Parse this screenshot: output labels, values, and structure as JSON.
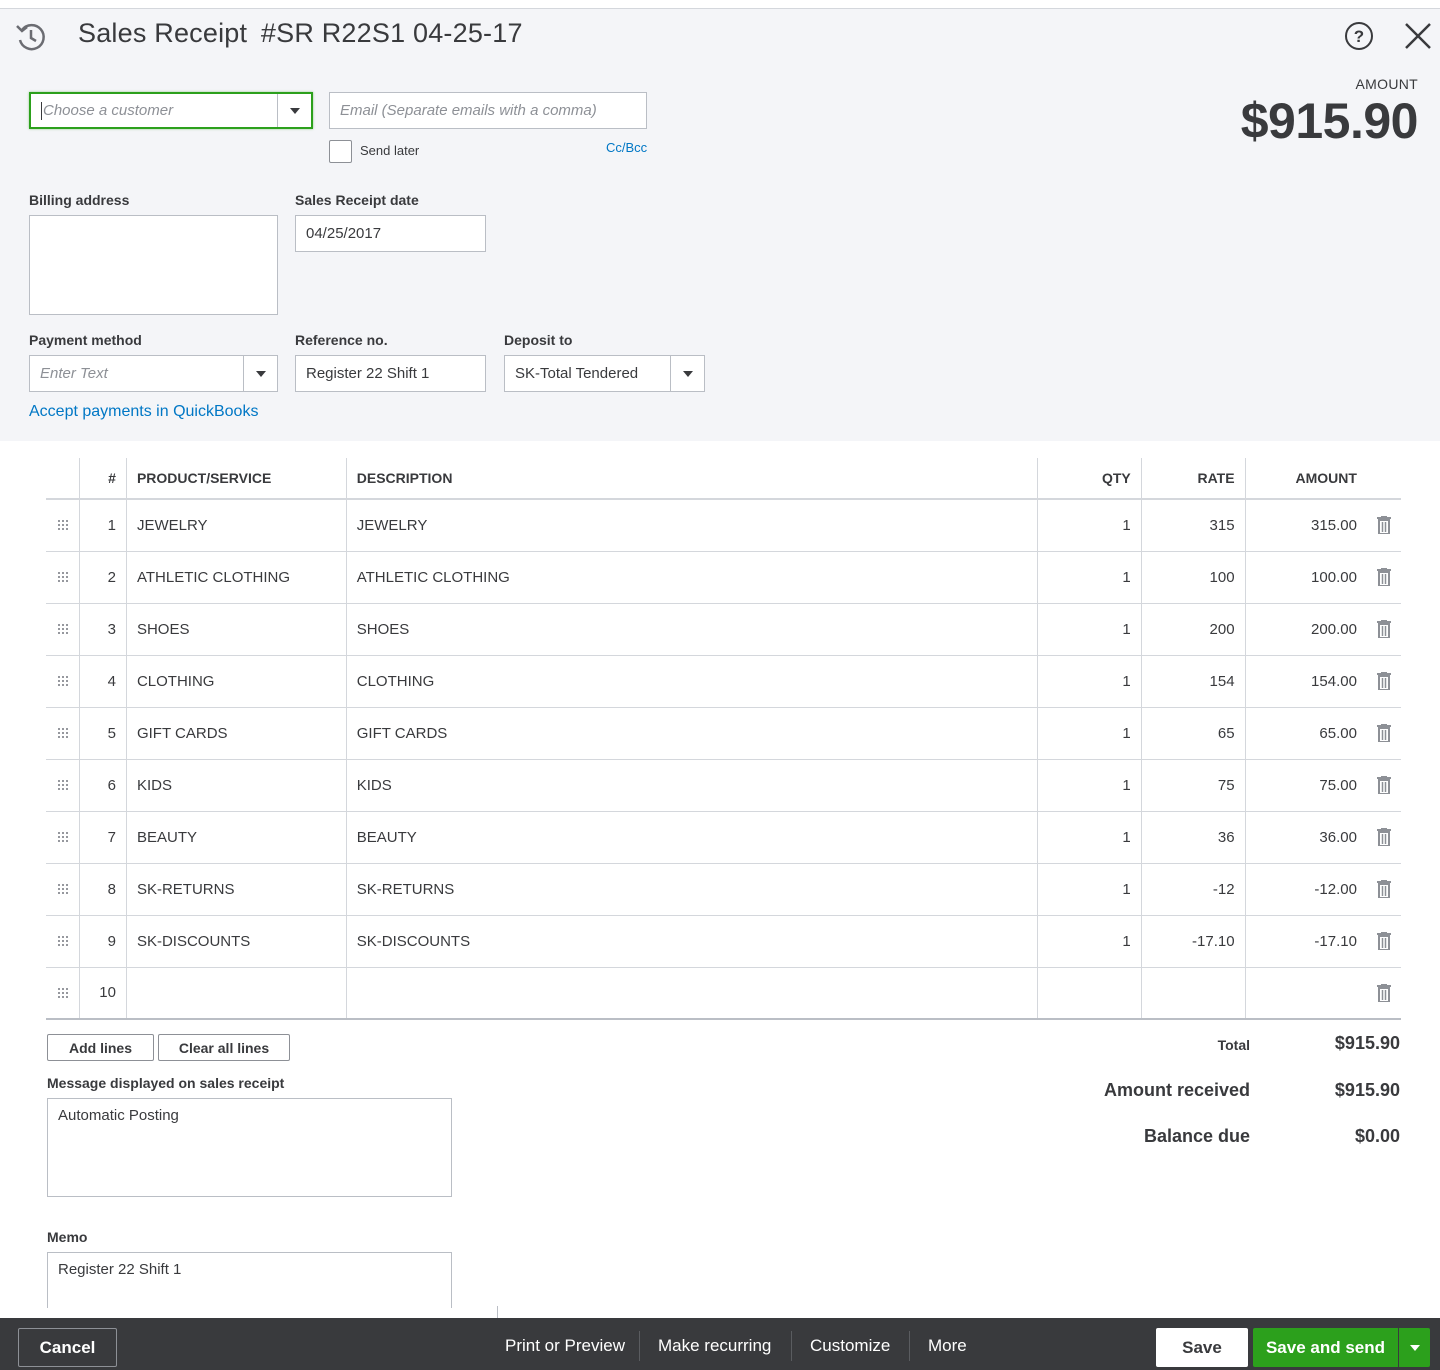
{
  "header": {
    "title": "Sales Receipt",
    "receipt_number": "#SR R22S1 04-25-17",
    "amount_label": "AMOUNT",
    "amount_value": "$915.90"
  },
  "form": {
    "customer_placeholder": "Choose a customer",
    "email_placeholder": "Email (Separate emails with a comma)",
    "send_later_label": "Send later",
    "send_later_checked": false,
    "cc_bcc_label": "Cc/Bcc",
    "billing_address_label": "Billing address",
    "billing_address_value": "",
    "sales_receipt_date_label": "Sales Receipt date",
    "sales_receipt_date_value": "04/25/2017",
    "payment_method_label": "Payment method",
    "payment_method_placeholder": "Enter Text",
    "reference_no_label": "Reference no.",
    "reference_no_value": "Register 22 Shift 1",
    "deposit_to_label": "Deposit to",
    "deposit_to_value": "SK-Total Tendered",
    "accept_payments_link": "Accept payments in QuickBooks"
  },
  "table": {
    "headers": {
      "num": "#",
      "product": "PRODUCT/SERVICE",
      "description": "DESCRIPTION",
      "qty": "QTY",
      "rate": "RATE",
      "amount": "AMOUNT"
    },
    "rows": [
      {
        "num": "1",
        "product": "JEWELRY",
        "description": "JEWELRY",
        "qty": "1",
        "rate": "315",
        "amount": "315.00"
      },
      {
        "num": "2",
        "product": "ATHLETIC CLOTHING",
        "description": "ATHLETIC CLOTHING",
        "qty": "1",
        "rate": "100",
        "amount": "100.00"
      },
      {
        "num": "3",
        "product": "SHOES",
        "description": "SHOES",
        "qty": "1",
        "rate": "200",
        "amount": "200.00"
      },
      {
        "num": "4",
        "product": "CLOTHING",
        "description": "CLOTHING",
        "qty": "1",
        "rate": "154",
        "amount": "154.00"
      },
      {
        "num": "5",
        "product": "GIFT CARDS",
        "description": "GIFT CARDS",
        "qty": "1",
        "rate": "65",
        "amount": "65.00"
      },
      {
        "num": "6",
        "product": "KIDS",
        "description": "KIDS",
        "qty": "1",
        "rate": "75",
        "amount": "75.00"
      },
      {
        "num": "7",
        "product": "BEAUTY",
        "description": "BEAUTY",
        "qty": "1",
        "rate": "36",
        "amount": "36.00"
      },
      {
        "num": "8",
        "product": "SK-RETURNS",
        "description": "SK-RETURNS",
        "qty": "1",
        "rate": "-12",
        "amount": "-12.00"
      },
      {
        "num": "9",
        "product": "SK-DISCOUNTS",
        "description": "SK-DISCOUNTS",
        "qty": "1",
        "rate": "-17.10",
        "amount": "-17.10"
      },
      {
        "num": "10",
        "product": "",
        "description": "",
        "qty": "",
        "rate": "",
        "amount": ""
      }
    ]
  },
  "actions": {
    "add_lines": "Add lines",
    "clear_all_lines": "Clear all lines"
  },
  "totals": {
    "total_label": "Total",
    "total_value": "$915.90",
    "amount_received_label": "Amount received",
    "amount_received_value": "$915.90",
    "balance_due_label": "Balance due",
    "balance_due_value": "$0.00"
  },
  "message": {
    "label": "Message displayed on sales receipt",
    "value": "Automatic Posting"
  },
  "memo": {
    "label": "Memo",
    "value": "Register 22 Shift 1"
  },
  "footer": {
    "cancel": "Cancel",
    "print_or_preview": "Print or Preview",
    "make_recurring": "Make recurring",
    "customize": "Customize",
    "more": "More",
    "save": "Save",
    "save_and_send": "Save and send"
  },
  "colors": {
    "accent_green": "#2ca01c",
    "link_blue": "#0077c5",
    "footer_bg": "#393a3d",
    "top_bg": "#f4f5f8"
  },
  "icons": {
    "header_left": "recent-transactions-icon",
    "help": "help-question-icon",
    "close": "close-x-icon",
    "row_drag": "drag-handle-icon",
    "row_delete": "trash-icon"
  }
}
